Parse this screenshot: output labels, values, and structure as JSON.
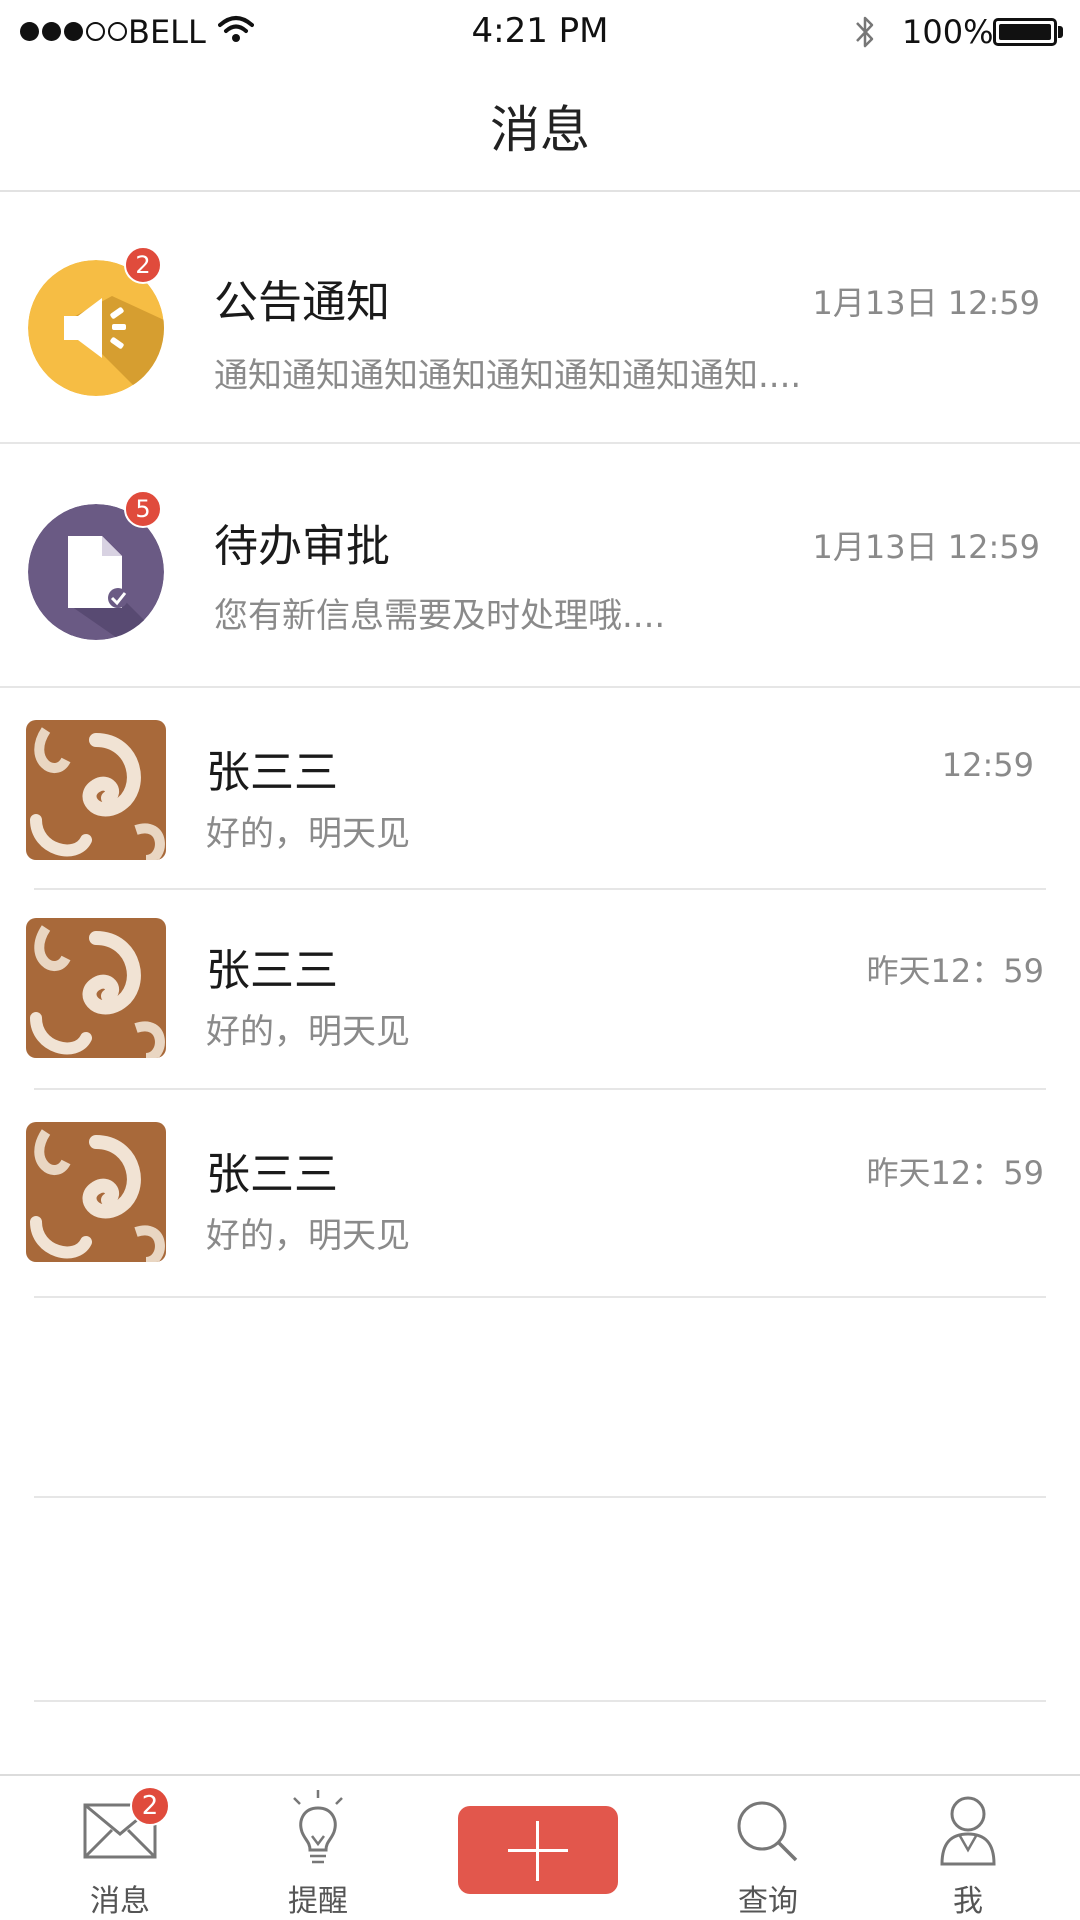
{
  "status_bar": {
    "carrier": "BELL",
    "time": "4:21 PM",
    "battery": "100%",
    "signal_filled": 3,
    "signal_empty": 2,
    "icons": [
      "wifi-icon",
      "bluetooth-icon",
      "battery-icon"
    ]
  },
  "nav": {
    "title": "消息"
  },
  "system_items": [
    {
      "title": "公告通知",
      "time": "1月13日   12:59",
      "preview": "通知通知通知通知通知通知通知通知....",
      "badge": "2",
      "icon": "speaker-icon",
      "color": "#f6bd44"
    },
    {
      "title": "待办审批",
      "time": "1月13日   12:59",
      "preview": "您有新信息需要及时处理哦....",
      "badge": "5",
      "icon": "document-check-icon",
      "color": "#6a5a84"
    }
  ],
  "chats": [
    {
      "name": "张三三",
      "time": "12:59",
      "preview": "好的，明天见"
    },
    {
      "name": "张三三",
      "time": "昨天12：59",
      "preview": "好的，明天见"
    },
    {
      "name": "张三三",
      "time": "昨天12：59",
      "preview": "好的，明天见"
    }
  ],
  "tabs": [
    {
      "label": "消息",
      "icon": "envelope-icon",
      "badge": "2"
    },
    {
      "label": "提醒",
      "icon": "lightbulb-icon"
    },
    {
      "label": "",
      "icon": "plus-icon"
    },
    {
      "label": "查询",
      "icon": "search-icon"
    },
    {
      "label": "我",
      "icon": "person-icon"
    }
  ],
  "colors": {
    "accent": "#e2574c",
    "badge": "#e04b3c"
  }
}
